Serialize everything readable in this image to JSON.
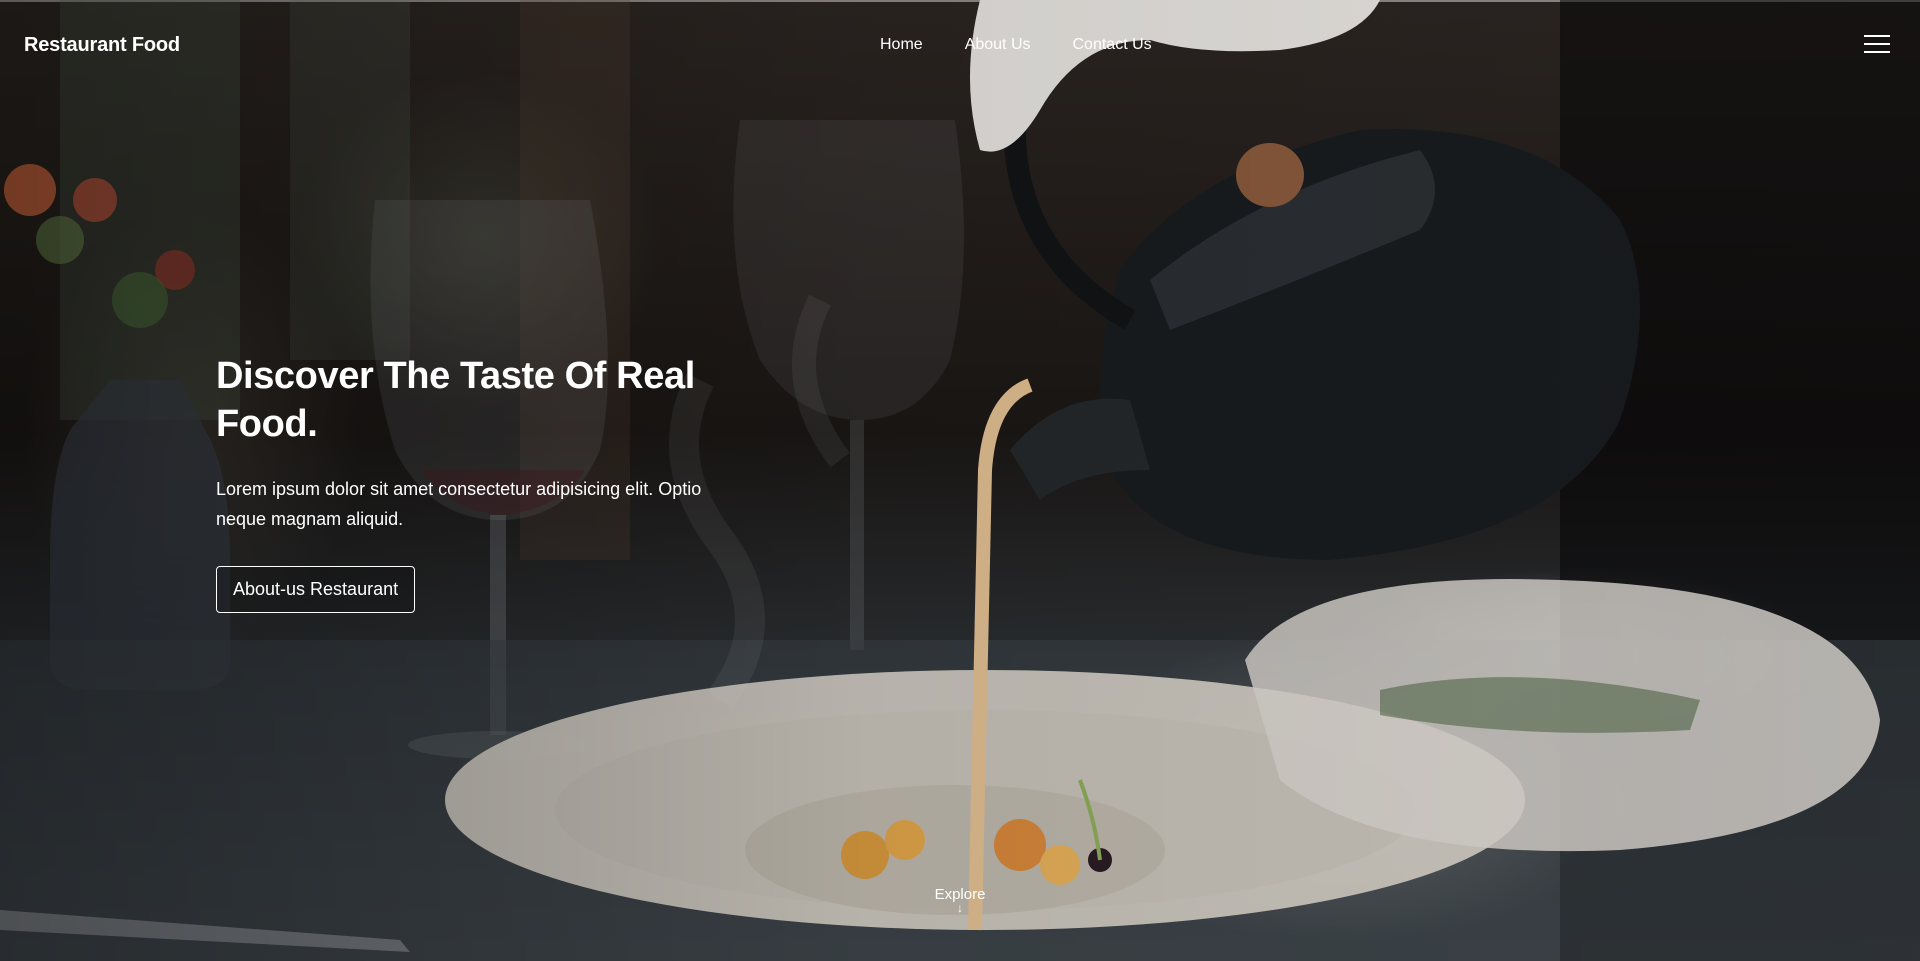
{
  "brand": {
    "name": "Restaurant Food"
  },
  "nav": {
    "links": [
      {
        "label": "Home"
      },
      {
        "label": "About Us"
      },
      {
        "label": "Contact Us"
      }
    ],
    "menu_icon": "hamburger-icon"
  },
  "hero": {
    "title": "Discover The Taste Of Real Food.",
    "text": "Lorem ipsum dolor sit amet consectetur adipisicing elit. Optio neque magnam aliquid.",
    "button_label": "About-us Restaurant",
    "explore_label": "Explore",
    "explore_icon": "arrow-down-icon",
    "background_image": "teapot pouring sauce onto a plated dish at a restaurant table"
  },
  "colors": {
    "text": "#ffffff",
    "background": "#1b1715"
  }
}
